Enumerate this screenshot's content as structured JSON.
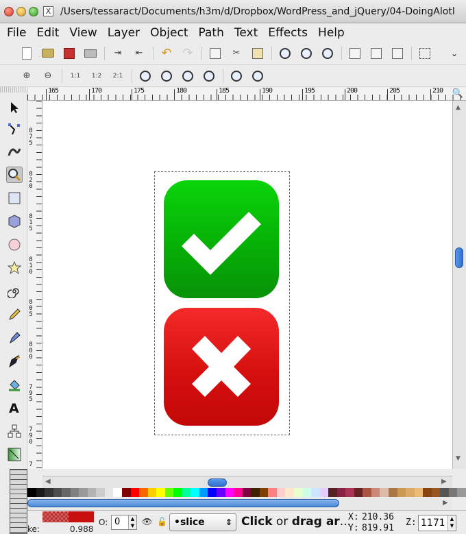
{
  "window": {
    "title": "/Users/tessaract/Documents/h3m/d/Dropbox/WordPress_and_jQuery/04-DoingAlotl"
  },
  "menu": [
    {
      "label": "File"
    },
    {
      "label": "Edit"
    },
    {
      "label": "View"
    },
    {
      "label": "Layer"
    },
    {
      "label": "Object"
    },
    {
      "label": "Path"
    },
    {
      "label": "Text"
    },
    {
      "label": "Effects"
    },
    {
      "label": "Help"
    }
  ],
  "toolbar_commands": {
    "icons": [
      "new-document-icon",
      "open-folder-icon",
      "save-icon",
      "print-icon",
      "import-icon",
      "export-icon",
      "undo-icon",
      "redo-icon",
      "duplicate-icon",
      "cut-icon",
      "paste-icon",
      "zoom-selection-icon",
      "zoom-drawing-icon",
      "zoom-page-icon",
      "group-icon",
      "ungroup-icon",
      "paste-in-place-icon",
      "align-icon"
    ],
    "overflow": "⌄"
  },
  "toolbar_zoom": {
    "icons": [
      "zoom-in-icon",
      "zoom-out-icon",
      "zoom-1-1-icon",
      "zoom-1-2-icon",
      "zoom-2-1-icon",
      "zoom-selection-icon",
      "zoom-drawing-icon",
      "zoom-page-icon",
      "zoom-width-icon",
      "zoom-previous-icon",
      "zoom-next-icon"
    ],
    "labels": {
      "one_to_one": "1:1",
      "one_to_two": "1:2",
      "two_to_one": "2:1"
    }
  },
  "ruler": {
    "horizontal": [
      "165",
      "170",
      "175",
      "180",
      "185",
      "190",
      "195",
      "200",
      "205",
      "210"
    ],
    "vertical": [
      "8 7 5",
      "8 2 0",
      "8 1 5",
      "8 1 0",
      "8 0 5",
      "8 0 0",
      "7 9 5",
      "7 9 0",
      "7"
    ]
  },
  "tools": [
    "selector-tool-icon",
    "node-tool-icon",
    "tweak-tool-icon",
    "zoom-tool-icon",
    "rectangle-tool-icon",
    "3d-box-tool-icon",
    "ellipse-tool-icon",
    "star-tool-icon",
    "spiral-tool-icon",
    "pencil-tool-icon",
    "pen-tool-icon",
    "calligraphy-tool-icon",
    "paint-bucket-tool-icon",
    "text-tool-icon",
    "connector-tool-icon",
    "gradient-tool-icon"
  ],
  "canvas": {
    "objects": [
      {
        "name": "checkmark-button",
        "color_top": "#0ad40a",
        "color_bottom": "#089208"
      },
      {
        "name": "cross-button",
        "color_top": "#f32a2a",
        "color_bottom": "#c20808"
      }
    ]
  },
  "palette": {
    "colors": [
      "#000000",
      "#1a1a1a",
      "#333333",
      "#4d4d4d",
      "#666666",
      "#808080",
      "#999999",
      "#b3b3b3",
      "#cccccc",
      "#e6e6e6",
      "#ffffff",
      "#800000",
      "#ff0000",
      "#ff6600",
      "#ffcc00",
      "#ffff00",
      "#66ff00",
      "#00ff00",
      "#00ff99",
      "#00ffff",
      "#0099ff",
      "#0000ff",
      "#6600ff",
      "#ff00ff",
      "#ff0099",
      "#800040",
      "#402000",
      "#804000",
      "#ff8080",
      "#ffcccc",
      "#ffe6cc",
      "#e6ffcc",
      "#ccffe6",
      "#cce6ff",
      "#e6ccff",
      "#552222",
      "#882244",
      "#aa3355",
      "#662222",
      "#aa5544",
      "#cc8877",
      "#ddbbaa",
      "#aa7744",
      "#cc9955",
      "#ddaa66",
      "#eebb77",
      "#884411",
      "#995522",
      "#555555",
      "#777777",
      "#999999"
    ]
  },
  "status": {
    "stroke_label": "ke:",
    "opacity_value": "0.988",
    "opacity_label": "O:",
    "o_field": "0",
    "layer": "•slice",
    "message_bold1": "Click",
    "message_mid": " or ",
    "message_bold2": "drag ar",
    "message_tail": "...",
    "x_label": "X:",
    "x_value": "210.36",
    "y_label": "Y:",
    "y_value": "819.91",
    "zoom_label": "Z:",
    "zoom_value": "1171"
  }
}
